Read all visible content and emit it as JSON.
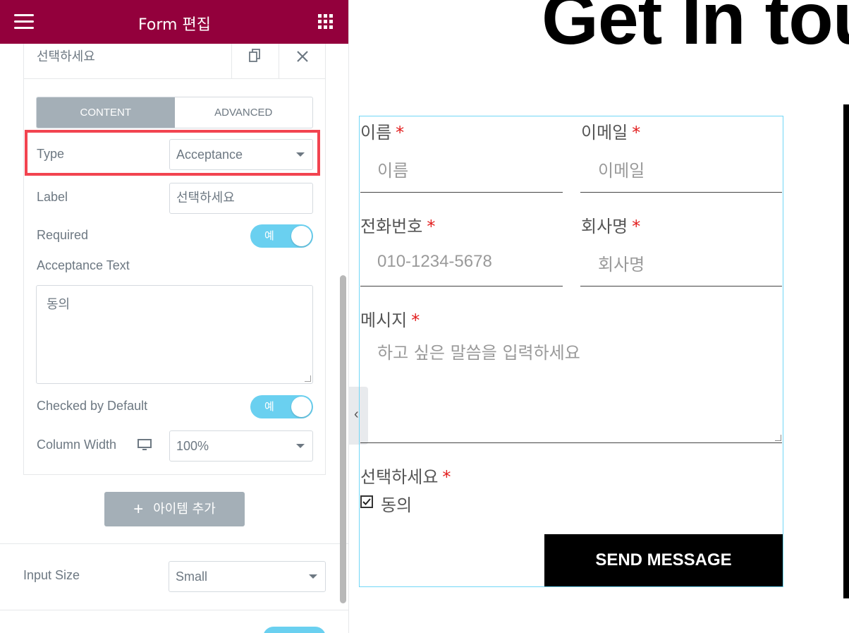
{
  "panel": {
    "title": "Form 편집",
    "repeater_item_title": "선택하세요",
    "tabs": [
      {
        "label": "CONTENT",
        "active": true
      },
      {
        "label": "ADVANCED",
        "active": false
      }
    ],
    "controls": {
      "type_label": "Type",
      "type_value": "Acceptance",
      "label_label": "Label",
      "label_value": "선택하세요",
      "required_label": "Required",
      "required_toggle": "예",
      "acceptance_text_label": "Acceptance Text",
      "acceptance_text_value": "동의",
      "checked_default_label": "Checked by Default",
      "checked_default_toggle": "예",
      "column_width_label": "Column Width",
      "column_width_value": "100%"
    },
    "add_item_label": "아이템 추가",
    "input_size_label": "Input Size",
    "input_size_value": "Small",
    "colors": {
      "header": "#93003c",
      "highlight": "#f24450",
      "toggle": "#6ad0f0"
    }
  },
  "preview": {
    "hero_text": "Get In tou",
    "fields": {
      "name_label": "이름",
      "name_placeholder": "이름",
      "email_label": "이메일",
      "email_placeholder": "이메일",
      "phone_label": "전화번호",
      "phone_placeholder": "010-1234-5678",
      "company_label": "회사명",
      "company_placeholder": "회사명",
      "message_label": "메시지",
      "message_placeholder": "하고 싶은 말씀을 입력하세요",
      "choice_label": "선택하세요",
      "choice_option": "동의",
      "required_mark": "*"
    },
    "send_label": "SEND MESSAGE"
  }
}
